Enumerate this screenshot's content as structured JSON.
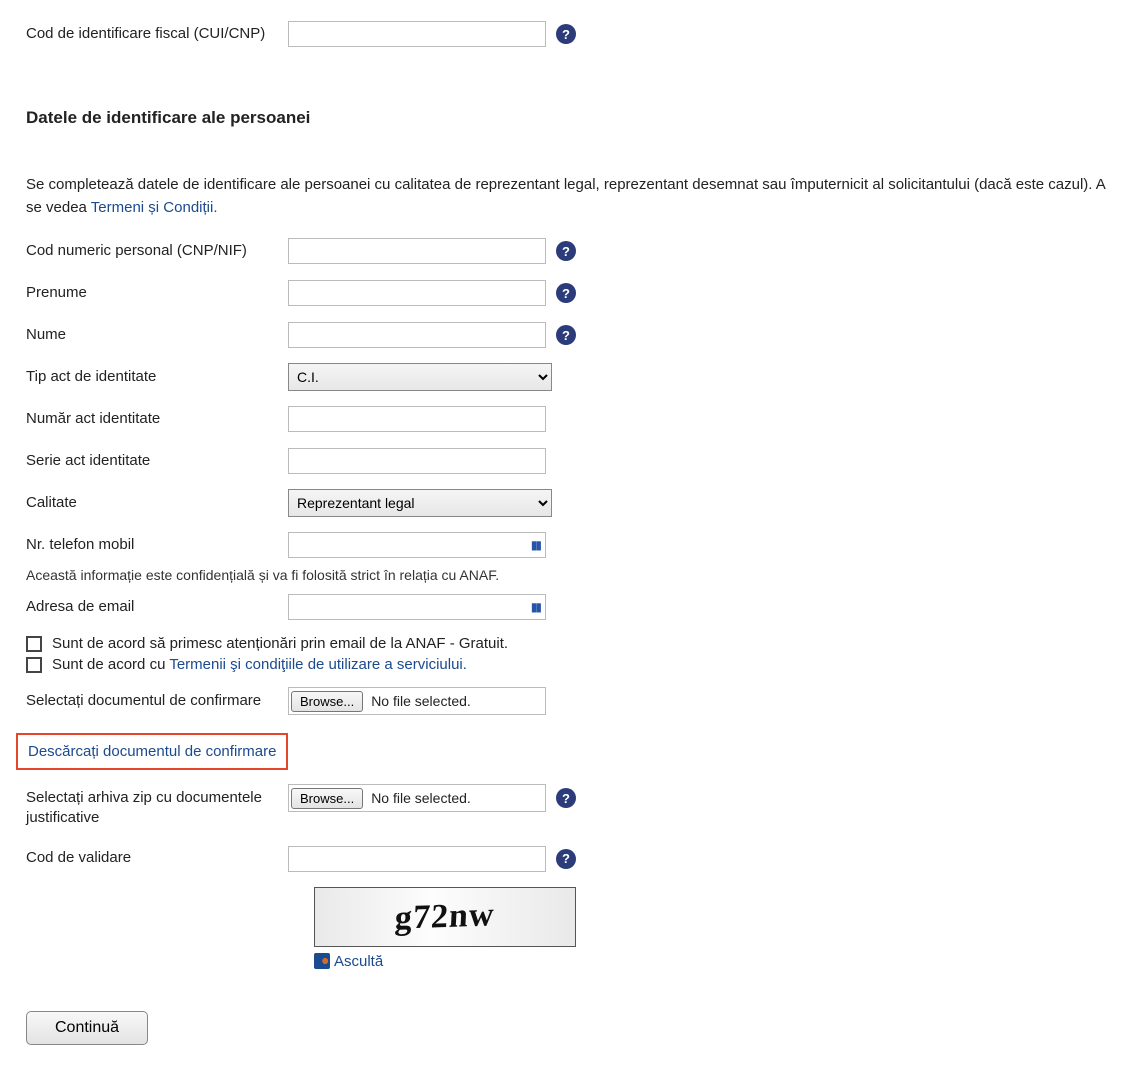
{
  "top": {
    "cui_label": "Cod de identificare fiscal (CUI/CNP)"
  },
  "section_title": "Datele de identificare ale persoanei",
  "intro": {
    "text_a": "Se completează datele de identificare ale persoanei cu calitatea de reprezentant legal, reprezentant desemnat sau împuternicit al solicitantului (dacă este cazul). A se vedea ",
    "terms_link": "Termeni și Condiții."
  },
  "fields": {
    "cnp": "Cod numeric personal (CNP/NIF)",
    "prenume": "Prenume",
    "nume": "Nume",
    "tip_act": "Tip act de identitate",
    "tip_act_selected": "C.I.",
    "numar_act": "Număr act identitate",
    "serie_act": "Serie act identitate",
    "calitate": "Calitate",
    "calitate_selected": "Reprezentant legal",
    "telefon": "Nr. telefon mobil",
    "telefon_note": "Această informație este confidențială și va fi folosită strict în relația cu ANAF.",
    "email": "Adresa de email"
  },
  "check": {
    "c1": "Sunt de acord să primesc atenționări prin email de la ANAF - Gratuit.",
    "c2_prefix": "Sunt de acord cu ",
    "c2_link": "Termenii şi condiţiile de utilizare a serviciului."
  },
  "file": {
    "confirm_label": "Selectați documentul de confirmare",
    "browse": "Browse...",
    "nofile": "No file selected.",
    "download_link": "Descărcați documentul de confirmare",
    "zip_label": "Selectați arhiva zip cu documentele justificative"
  },
  "validate": {
    "label": "Cod de validare",
    "captcha": "g72nw",
    "listen": "Ascultă"
  },
  "continue_label": "Continuă",
  "help_glyph": "?"
}
